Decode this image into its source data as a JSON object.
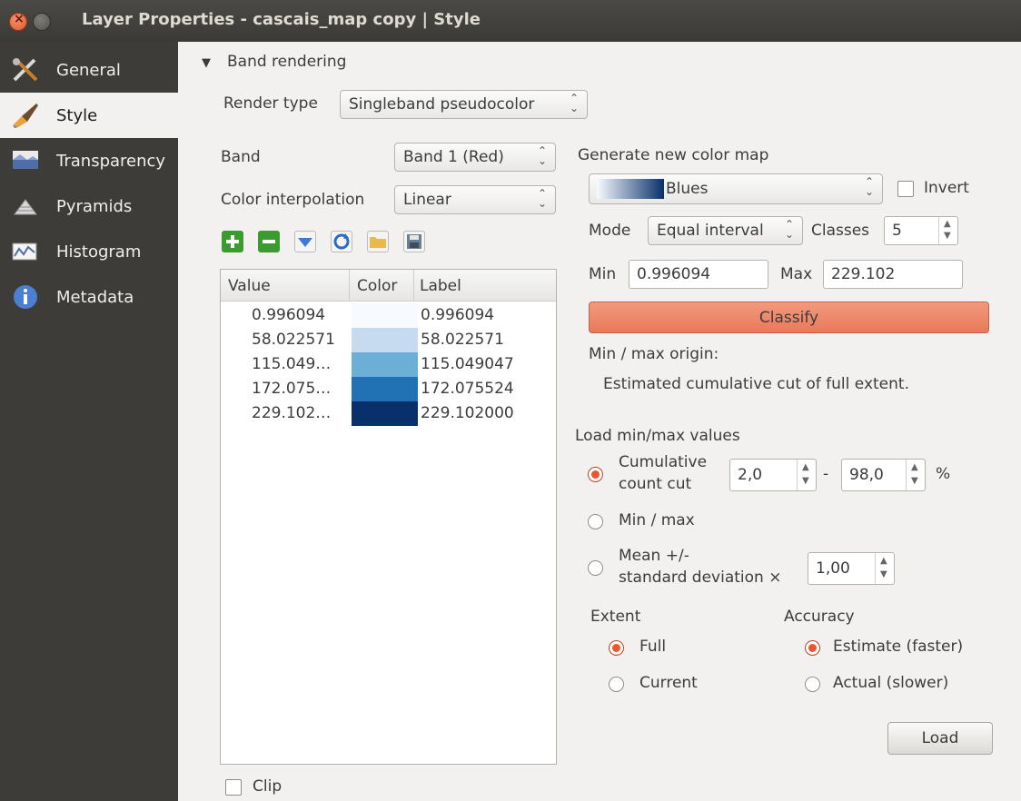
{
  "window": {
    "title": "Layer Properties - cascais_map copy | Style"
  },
  "sidebar": {
    "items": [
      {
        "label": "General",
        "icon": "tools-icon"
      },
      {
        "label": "Style",
        "icon": "brush-icon"
      },
      {
        "label": "Transparency",
        "icon": "transparency-icon"
      },
      {
        "label": "Pyramids",
        "icon": "pyramids-icon"
      },
      {
        "label": "Histogram",
        "icon": "histogram-icon"
      },
      {
        "label": "Metadata",
        "icon": "info-icon"
      }
    ],
    "active": "Style"
  },
  "band_rendering": {
    "section_label": "Band rendering",
    "render_type_label": "Render type",
    "render_type_value": "Singleband pseudocolor",
    "band_label": "Band",
    "band_value": "Band 1 (Red)",
    "interp_label": "Color interpolation",
    "interp_value": "Linear"
  },
  "table": {
    "headers": [
      "Value",
      "Color",
      "Label"
    ],
    "rows": [
      {
        "value": "0.996094",
        "color": "#f7fbff",
        "label": "0.996094"
      },
      {
        "value": "58.022571",
        "color": "#c6dbef",
        "label": "58.022571"
      },
      {
        "value": "115.049…",
        "color": "#6baed6",
        "label": "115.049047"
      },
      {
        "value": "172.075…",
        "color": "#2171b5",
        "label": "172.075524"
      },
      {
        "value": "229.102…",
        "color": "#08306b",
        "label": "229.102000"
      }
    ]
  },
  "clip_label": "Clip",
  "colormap": {
    "heading": "Generate new color map",
    "ramp": "Blues",
    "invert_label": "Invert",
    "mode_label": "Mode",
    "mode_value": "Equal interval",
    "classes_label": "Classes",
    "classes_value": "5",
    "min_label": "Min",
    "min_value": "0.996094",
    "max_label": "Max",
    "max_value": "229.102",
    "classify_label": "Classify",
    "origin_label": "Min / max origin:",
    "origin_value": "Estimated cumulative cut of full extent."
  },
  "load_minmax": {
    "heading": "Load min/max values",
    "cumulative_line1": "Cumulative",
    "cumulative_line2": "count cut",
    "cut_low": "2,0",
    "cut_dash": "-",
    "cut_high": "98,0",
    "percent": "%",
    "minmax_label": "Min / max",
    "mean_line1": "Mean +/-",
    "mean_line2": "standard deviation ×",
    "stddev_value": "1,00",
    "extent_label": "Extent",
    "extent_full": "Full",
    "extent_current": "Current",
    "accuracy_label": "Accuracy",
    "accuracy_estimate": "Estimate (faster)",
    "accuracy_actual": "Actual (slower)",
    "load_button": "Load"
  },
  "colors": {
    "accent": "#e9582d",
    "classify_button": "#ee8a6c",
    "sidebar_bg": "#3d3c39"
  }
}
